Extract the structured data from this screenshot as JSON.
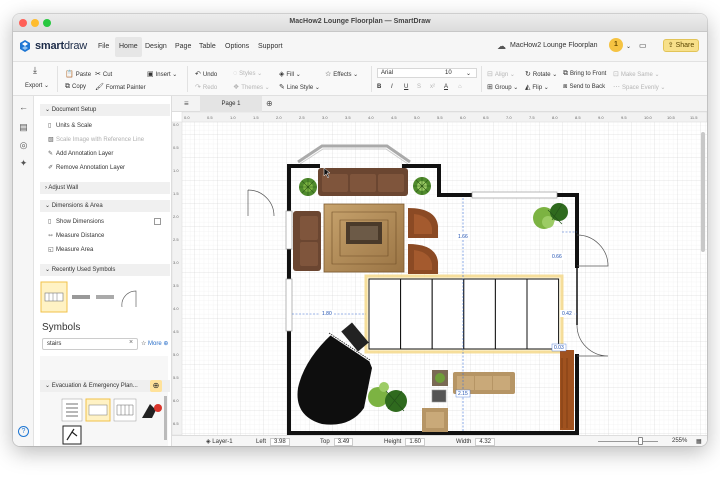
{
  "window": {
    "title": "MacHow2 Lounge Floorplan — SmartDraw"
  },
  "brand": {
    "name_bold": "smart",
    "name_light": "draw"
  },
  "menu": {
    "items": [
      "File",
      "Home",
      "Design",
      "Page",
      "Table",
      "Options",
      "Support"
    ],
    "active": "Home"
  },
  "document": {
    "name": "MacHow2 Lounge Floorplan"
  },
  "user": {
    "badge": "1"
  },
  "share": {
    "label": "Share"
  },
  "toolbar": {
    "export": "Export",
    "paste": "Paste",
    "copy": "Copy",
    "cut": "Cut",
    "format_painter": "Format Painter",
    "insert": "Insert",
    "undo": "Undo",
    "redo": "Redo",
    "styles": "Styles",
    "themes": "Themes",
    "fill": "Fill",
    "line_style": "Line Style",
    "effects": "Effects",
    "font": "Arial",
    "font_size": "10",
    "align": "Align",
    "group": "Group",
    "rotate": "Rotate",
    "flip": "Flip",
    "bring_to_front": "Bring to Front",
    "send_to_back": "Send to Back",
    "make_same": "Make Same",
    "space_evenly": "Space Evenly"
  },
  "panel": {
    "document_setup": "Document Setup",
    "units_scale": "Units & Scale",
    "scale_image": "Scale Image with Reference Line",
    "add_annotation": "Add Annotation Layer",
    "remove_annotation": "Remove Annotation Layer",
    "adjust_wall": "Adjust Wall",
    "dimensions_area": "Dimensions & Area",
    "show_dimensions": "Show Dimensions",
    "measure_distance": "Measure Distance",
    "measure_area": "Measure Area",
    "recently_used": "Recently Used Symbols",
    "symbols_title": "Symbols",
    "search_value": "stairs",
    "more": "More",
    "evacuation": "Evacuation & Emergency Plan..."
  },
  "page": {
    "tab": "Page 1"
  },
  "ruler": {
    "ticks": [
      "0.0",
      "0.5",
      "1.0",
      "1.5",
      "2.0",
      "2.5",
      "3.0",
      "3.5",
      "4.0",
      "4.5",
      "5.0",
      "5.5",
      "6.0",
      "6.5",
      "7.0",
      "7.5",
      "8.0",
      "8.5",
      "9.0",
      "9.5",
      "10.0",
      "10.5",
      "11.5"
    ]
  },
  "vruler": {
    "ticks": [
      "0.0",
      "0.5",
      "1.0",
      "1.5",
      "2.0",
      "2.5",
      "3.0",
      "3.5",
      "4.0",
      "4.5",
      "5.0",
      "5.5",
      "6.0",
      "6.5"
    ]
  },
  "dimensions": {
    "d1": "1.66",
    "d2": "1.80",
    "d3": "0.66",
    "d4": "0.42",
    "d5": "0.03",
    "d6": "2.15"
  },
  "status": {
    "layer": "Layer-1",
    "left_label": "Left",
    "left_value": "3.98",
    "top_label": "Top",
    "top_value": "3.49",
    "height_label": "Height",
    "height_value": "1.60",
    "width_label": "Width",
    "width_value": "4.32",
    "zoom": "255%"
  },
  "colors": {
    "accent": "#1e76d3",
    "wall": "#111111",
    "sofa": "#6b4631",
    "plant": "#4f8a2c"
  }
}
